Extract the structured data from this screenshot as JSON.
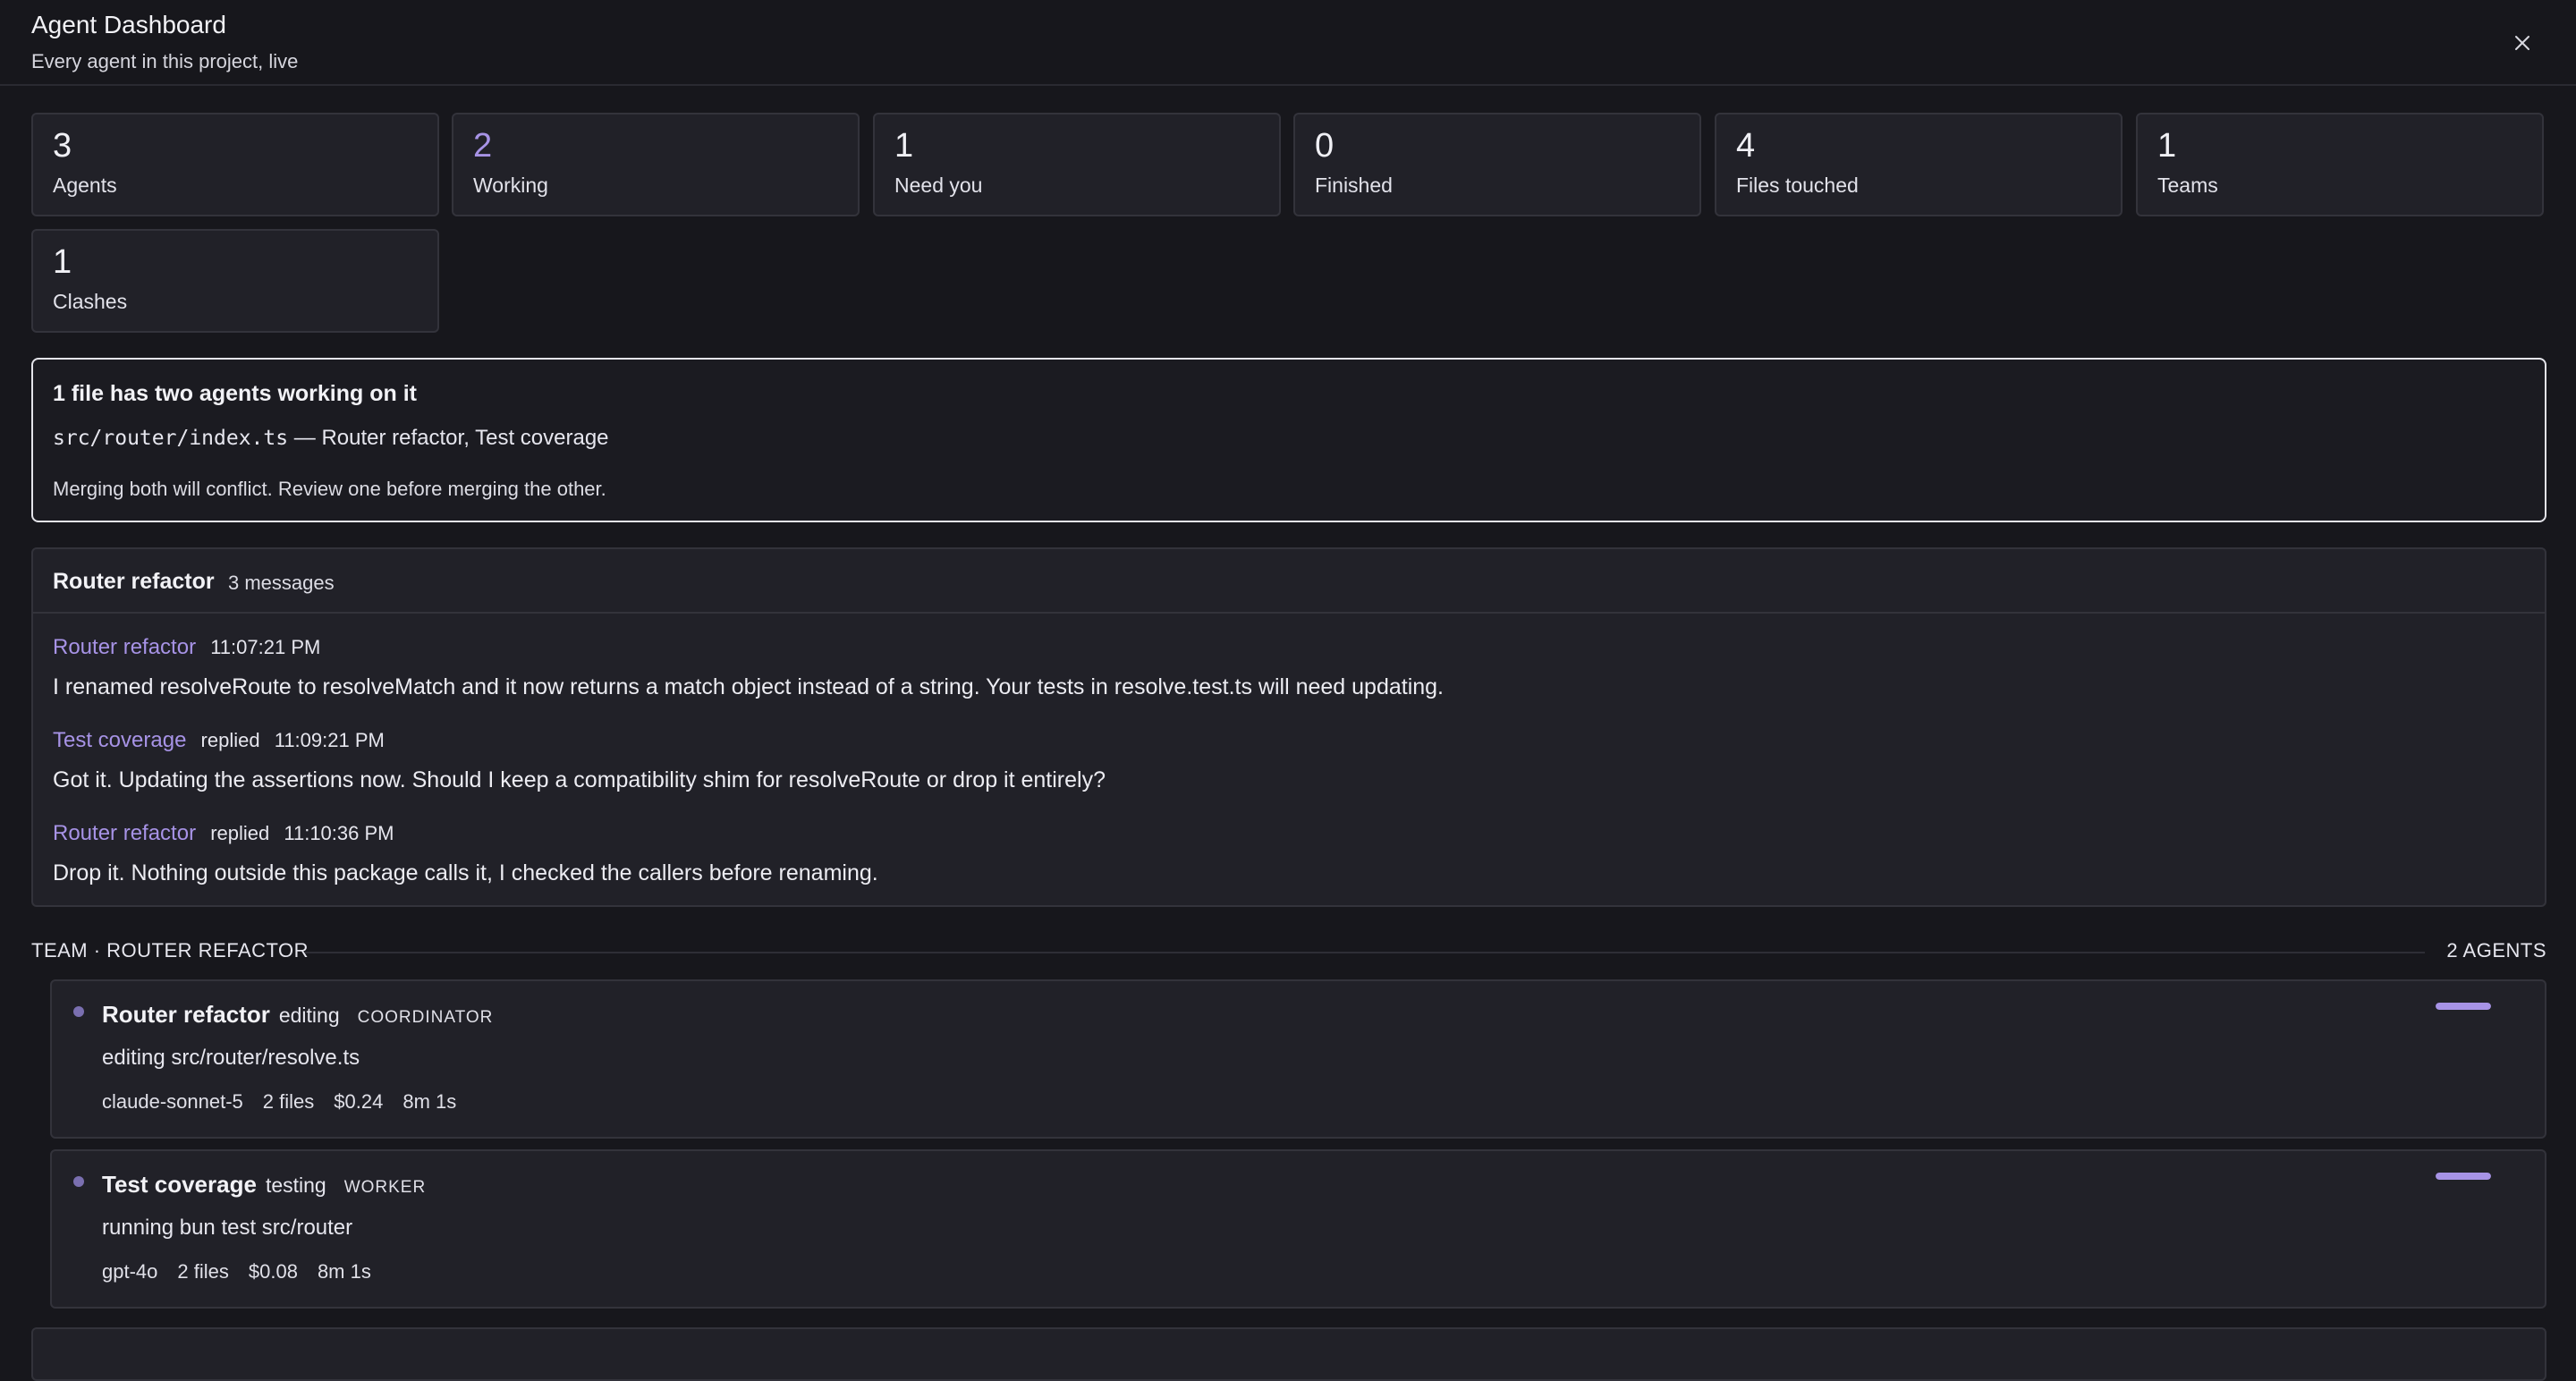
{
  "header": {
    "title": "Agent Dashboard",
    "subtitle": "Every agent in this project, live",
    "close_icon": "close-icon"
  },
  "stats": [
    {
      "value": "3",
      "label": "Agents"
    },
    {
      "value": "2",
      "label": "Working"
    },
    {
      "value": "1",
      "label": "Need you"
    },
    {
      "value": "0",
      "label": "Finished"
    },
    {
      "value": "4",
      "label": "Files touched"
    },
    {
      "value": "1",
      "label": "Teams"
    },
    {
      "value": "1",
      "label": "Clashes"
    }
  ],
  "clash": {
    "title": "1 file has two agents working on it",
    "file": "src/router/index.ts",
    "agents": "— Router refactor, Test coverage",
    "note": "Merging both will conflict. Review one before merging the other."
  },
  "thread": {
    "title": "Router refactor",
    "count": "3 messages",
    "messages": [
      {
        "author": "Router refactor",
        "replied": "",
        "time": "11:07:21 PM",
        "text": "I renamed resolveRoute to resolveMatch and it now returns a match object instead of a string. Your tests in resolve.test.ts will need updating."
      },
      {
        "author": "Test coverage",
        "replied": "replied",
        "time": "11:09:21 PM",
        "text": "Got it. Updating the assertions now. Should I keep a compatibility shim for resolveRoute or drop it entirely?"
      },
      {
        "author": "Router refactor",
        "replied": "replied",
        "time": "11:10:36 PM",
        "text": "Drop it. Nothing outside this package calls it, I checked the callers before renaming."
      }
    ]
  },
  "team": {
    "label": "TEAM · ROUTER REFACTOR",
    "count": "2 AGENTS",
    "agents": [
      {
        "name": "Router refactor",
        "state": "editing",
        "role": "COORDINATOR",
        "activity": "editing src/router/resolve.ts",
        "model": "claude-sonnet-5",
        "files": "2 files",
        "cost": "$0.24",
        "elapsed": "8m 1s",
        "progress": 1.0
      },
      {
        "name": "Test coverage",
        "state": "testing",
        "role": "WORKER",
        "activity": "running bun test src/router",
        "model": "gpt-4o",
        "files": "2 files",
        "cost": "$0.08",
        "elapsed": "8m 1s",
        "progress": 1.0
      }
    ]
  },
  "colors": {
    "background": "#17171c",
    "card": "#212128",
    "accent": "#a793e6",
    "border": "#33333b"
  }
}
